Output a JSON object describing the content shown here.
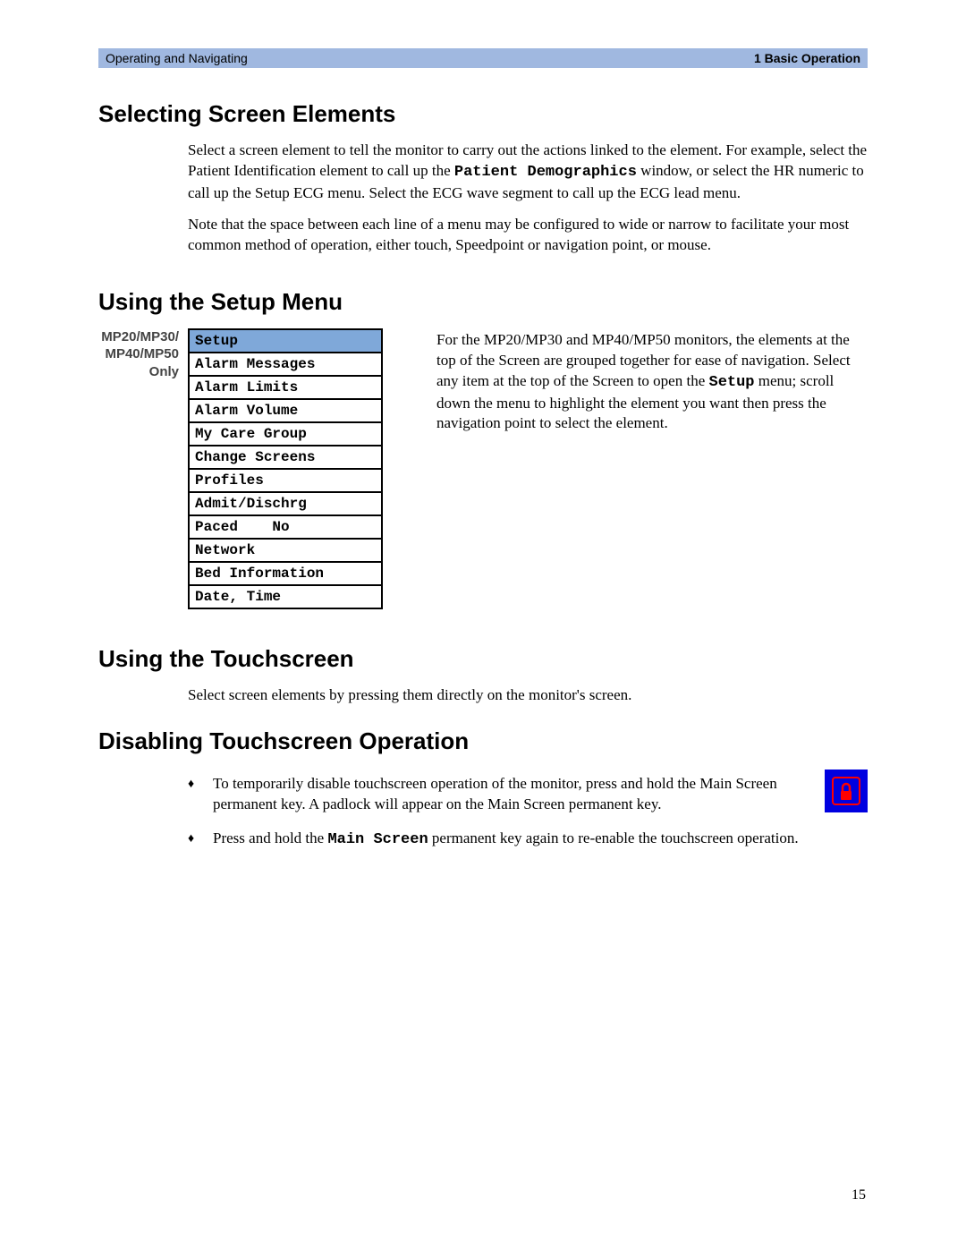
{
  "header": {
    "left": "Operating and Navigating",
    "right": "1 Basic Operation"
  },
  "section1": {
    "heading": "Selecting Screen Elements",
    "p1a": "Select a screen element to tell the monitor to carry out the actions linked to the element. For example, select the Patient Identification element to call up the ",
    "p1_code": "Patient Demographics",
    "p1b": " window, or select the HR numeric to call up the Setup ECG menu. Select the ECG wave segment to call up the ECG lead menu.",
    "p2": "Note that the space between each line of a menu may be configured to wide or narrow to facilitate your most common method of operation, either touch, Speedpoint or navigation point, or mouse."
  },
  "section2": {
    "heading": "Using the Setup Menu",
    "sidebar": "MP20/MP30/\nMP40/MP50\nOnly",
    "table": {
      "header": "Setup",
      "rows": [
        "Alarm Messages",
        "Alarm Limits",
        "Alarm Volume",
        "My Care Group",
        "Change Screens",
        "Profiles",
        "Admit/Dischrg",
        "Paced    No",
        "Network",
        "Bed Information",
        "Date, Time"
      ]
    },
    "para_a": "For the MP20/MP30 and MP40/MP50 monitors, the elements at the top of the Screen are grouped together for ease of navigation. Select any item at the top of the Screen to open the ",
    "para_code": "Setup",
    "para_b": " menu; scroll down the menu to highlight the element you want then press the navigation point to select the element."
  },
  "section3": {
    "heading": "Using the Touchscreen",
    "p1": "Select screen elements by pressing them directly on the monitor's screen."
  },
  "section4": {
    "heading": "Disabling Touchscreen Operation",
    "b1": "To temporarily disable touchscreen operation of the monitor, press and hold the Main Screen permanent key. A padlock will appear on the Main Screen permanent key.",
    "b2a": "Press and hold the ",
    "b2_code": "Main Screen",
    "b2b": " permanent key again to re-enable the touchscreen operation."
  },
  "page_number": "15"
}
